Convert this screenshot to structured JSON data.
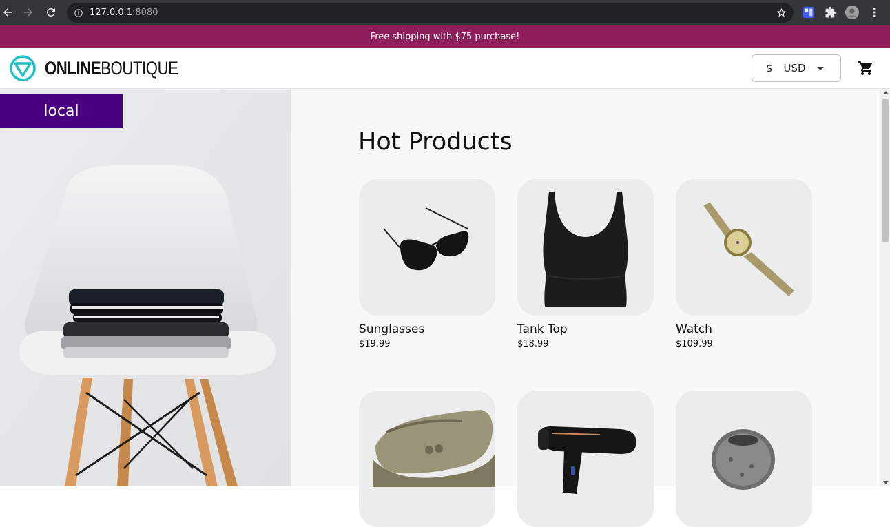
{
  "browser": {
    "url_host": "127.0.0.1",
    "url_port": ":8080"
  },
  "banner": {
    "text": "Free shipping with $75 purchase!"
  },
  "header": {
    "logo_bold": "ONLINE",
    "logo_light": "BOUTIQUE",
    "currency_symbol": "$",
    "currency_code": "USD"
  },
  "hero": {
    "env_label": "local"
  },
  "main": {
    "title": "Hot Products",
    "products": [
      {
        "name": "Sunglasses",
        "price": "$19.99"
      },
      {
        "name": "Tank Top",
        "price": "$18.99"
      },
      {
        "name": "Watch",
        "price": "$109.99"
      },
      {
        "name": "",
        "price": ""
      },
      {
        "name": "",
        "price": ""
      },
      {
        "name": "",
        "price": ""
      }
    ]
  },
  "colors": {
    "banner": "#8e1e5a",
    "env_badge": "#4b0082",
    "logo_accent": "#1fbfc4"
  }
}
